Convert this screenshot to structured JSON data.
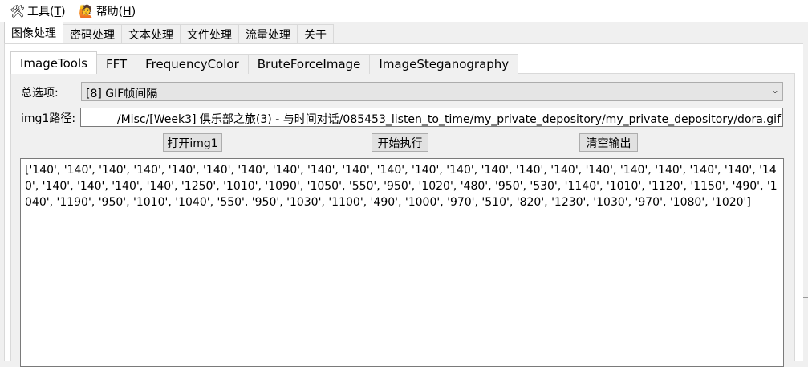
{
  "menu": [
    {
      "label": "工具(",
      "mnemonic": "T",
      "tail": ")",
      "icon": "tools-icon"
    },
    {
      "label": "帮助(",
      "mnemonic": "H",
      "tail": ")",
      "icon": "help-person-icon"
    }
  ],
  "main_tabs": [
    "图像处理",
    "密码处理",
    "文本处理",
    "文件处理",
    "流量处理",
    "关于"
  ],
  "main_tab_active": "图像处理",
  "sub_tabs": [
    "ImageTools",
    "FFT",
    "FrequencyColor",
    "BruteForceImage",
    "ImageSteganography"
  ],
  "sub_tab_active": "ImageTools",
  "form": {
    "option_label": "总选项:",
    "option_value": "[8] GIF帧间隔",
    "path_label": "img1路径:",
    "path_value": "/Misc/[Week3] 俱乐部之旅(3) - 与时间对话/085453_listen_to_time/my_private_depository/my_private_depository/dora.gif"
  },
  "buttons": {
    "open": "打开img1",
    "run": "开始执行",
    "clear": "清空输出"
  },
  "output_text": "['140', '140', '140', '140', '140', '140', '140', '140', '140', '140', '140', '140', '140', '140', '140', '140', '140', '140', '140', '140', '140', '140', '140', '140', '140', '140', '1250', '1010', '1090', '1050', '550', '950', '1020', '480', '950', '530', '1140', '1010', '1120', '1150', '490', '1040', '1190', '950', '1010', '1040', '550', '950', '1030', '1100', '490', '1000', '970', '510', '820', '1230', '1030', '970', '1080', '1020']"
}
